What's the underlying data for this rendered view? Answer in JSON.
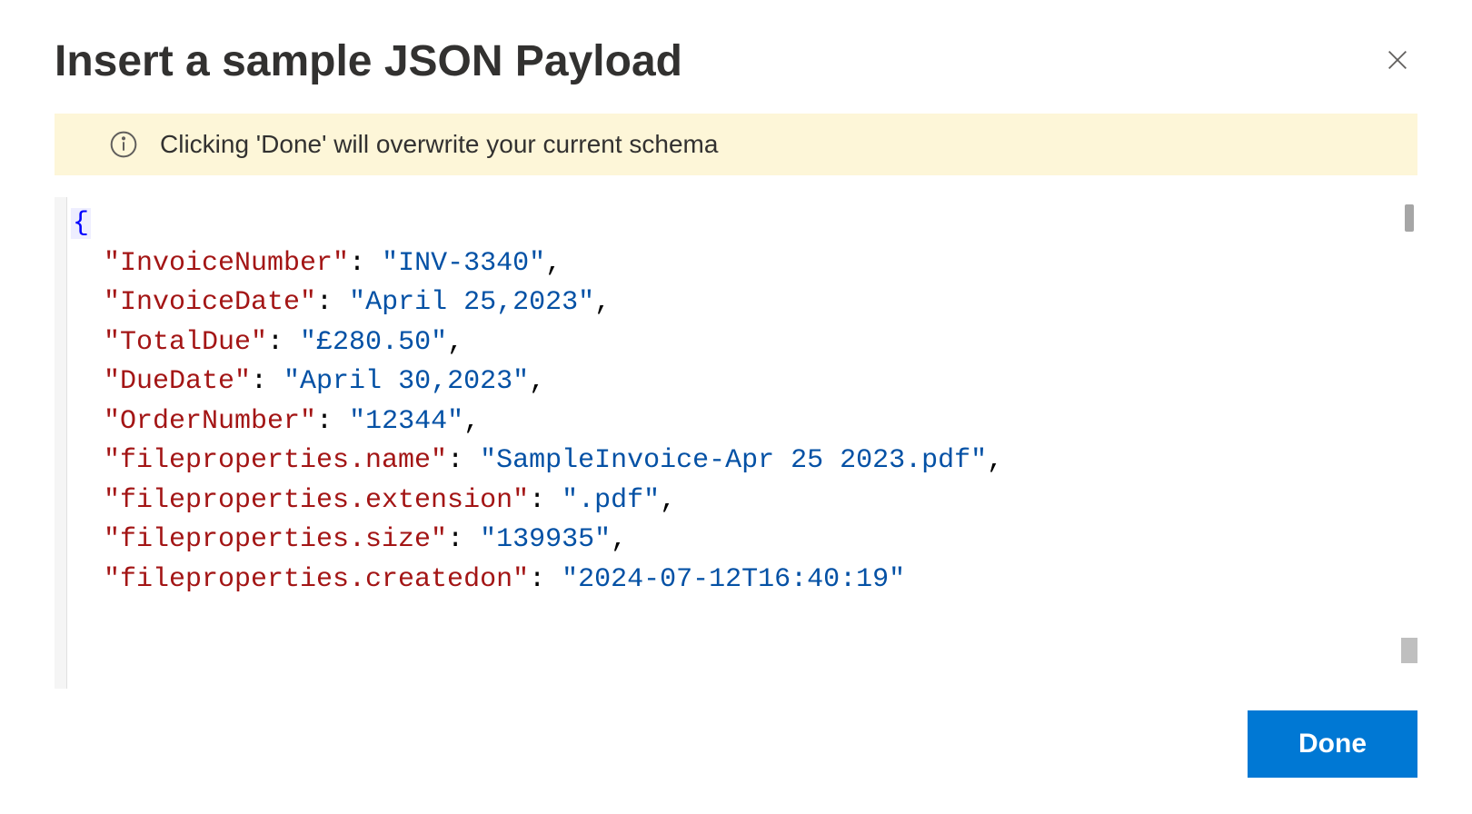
{
  "dialog": {
    "title": "Insert a sample JSON Payload",
    "info_message": "Clicking 'Done' will overwrite your current schema",
    "done_label": "Done"
  },
  "json_payload": {
    "open_brace": "{",
    "properties": [
      {
        "key": "\"InvoiceNumber\"",
        "value": "\"INV-3340\"",
        "comma": ","
      },
      {
        "key": "\"InvoiceDate\"",
        "value": "\"April 25,2023\"",
        "comma": ","
      },
      {
        "key": "\"TotalDue\"",
        "value": "\"£280.50\"",
        "comma": ","
      },
      {
        "key": "\"DueDate\"",
        "value": "\"April 30,2023\"",
        "comma": ","
      },
      {
        "key": "\"OrderNumber\"",
        "value": "\"12344\"",
        "comma": ","
      },
      {
        "key": "\"fileproperties.name\"",
        "value": "\"SampleInvoice-Apr 25 2023.pdf\"",
        "comma": ","
      },
      {
        "key": "\"fileproperties.extension\"",
        "value": "\".pdf\"",
        "comma": ","
      },
      {
        "key": "\"fileproperties.size\"",
        "value": "\"139935\"",
        "comma": ","
      },
      {
        "key": "\"fileproperties.createdon\"",
        "value": "\"2024-07-12T16:40:19\"",
        "comma": ""
      }
    ]
  }
}
